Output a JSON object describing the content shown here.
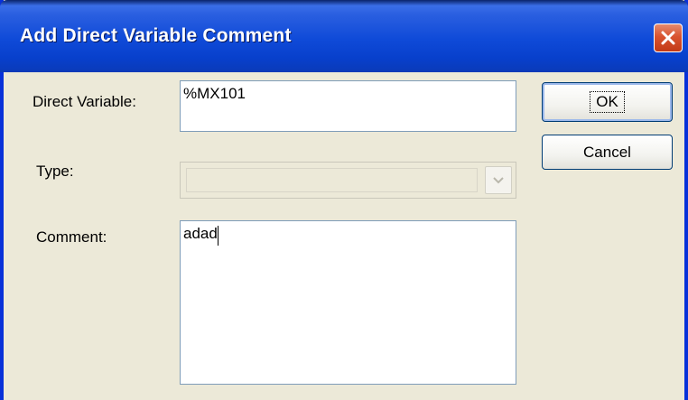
{
  "window": {
    "title": "Add Direct Variable Comment"
  },
  "fields": {
    "direct_variable_label": "Direct Variable:",
    "direct_variable_value": "%MX101",
    "type_label": "Type:",
    "type_value": "",
    "comment_label": "Comment:",
    "comment_value": "adad"
  },
  "buttons": {
    "ok_label": "OK",
    "cancel_label": "Cancel"
  },
  "icons": {
    "close": "close-x-icon",
    "dropdown": "chevron-down-icon"
  },
  "colors": {
    "titlebar": "#0f4ad8",
    "close_button": "#d9532f",
    "dialog_background": "#ece9d8"
  }
}
